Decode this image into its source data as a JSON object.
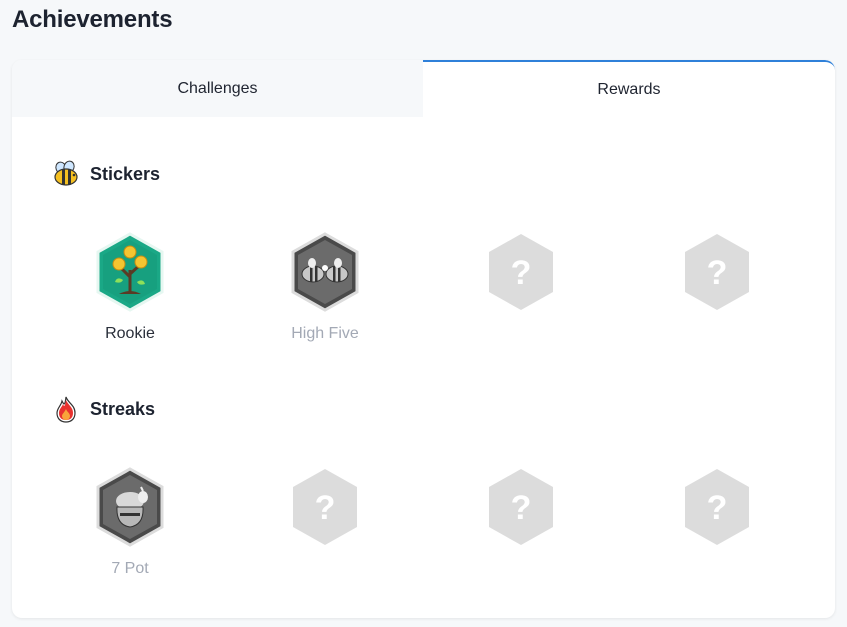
{
  "page": {
    "title": "Achievements"
  },
  "tabs": [
    {
      "label": "Challenges",
      "active": false
    },
    {
      "label": "Rewards",
      "active": true
    }
  ],
  "sections": {
    "stickers": {
      "title": "Stickers",
      "icon": "bee-icon",
      "badges": [
        {
          "label": "Rookie",
          "icon": "money-tree-icon",
          "status": "earned"
        },
        {
          "label": "High Five",
          "icon": "bees-high-five-icon",
          "status": "locked"
        },
        {
          "label": "",
          "icon": "question-mark-icon",
          "status": "hidden"
        },
        {
          "label": "",
          "icon": "question-mark-icon",
          "status": "hidden"
        }
      ]
    },
    "streaks": {
      "title": "Streaks",
      "icon": "flame-icon",
      "badges": [
        {
          "label": "7 Pot",
          "icon": "honey-pot-icon",
          "status": "locked"
        },
        {
          "label": "",
          "icon": "question-mark-icon",
          "status": "hidden"
        },
        {
          "label": "",
          "icon": "question-mark-icon",
          "status": "hidden"
        },
        {
          "label": "",
          "icon": "question-mark-icon",
          "status": "hidden"
        }
      ]
    }
  },
  "colors": {
    "accent": "#2f80d9",
    "earned_badge": "#1aa886",
    "locked_badge": "#4a4a4a",
    "hidden_badge": "#dcdcdc",
    "muted_text": "#a3a9b5"
  }
}
